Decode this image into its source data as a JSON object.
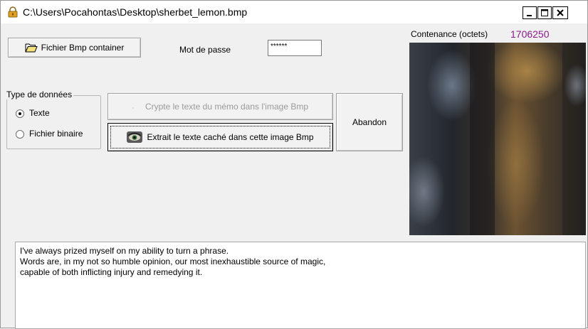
{
  "window": {
    "title": "C:\\Users\\Pocahontas\\Desktop\\sherbet_lemon.bmp",
    "controls": [
      "minimize",
      "maximize",
      "close"
    ]
  },
  "toolbar": {
    "open_button_label": "Fichier Bmp container",
    "open_button_icon": "folder-open-icon",
    "password_label": "Mot de passe",
    "password_value": "******"
  },
  "data_type_group": {
    "legend": "Type de données",
    "options": [
      {
        "label": "Texte",
        "selected": true
      },
      {
        "label": "Fichier binaire",
        "selected": false
      }
    ]
  },
  "actions": {
    "encrypt_label": "Crypte le texte du mémo dans l'image Bmp",
    "encrypt_enabled": false,
    "extract_label": "Extrait le texte caché dans cette image Bmp",
    "extract_icon": "eye-icon",
    "abort_label": "Abandon"
  },
  "capacity": {
    "label": "Contenance (octets)",
    "value": "1706250",
    "value_color": "#8b1a8b"
  },
  "memo": {
    "lines": [
      "I've always prized myself on my ability to turn a phrase.",
      "Words are, in my not so humble opinion, our most inexhaustible source of magic,",
      "capable of both inflicting injury and remedying it."
    ]
  }
}
